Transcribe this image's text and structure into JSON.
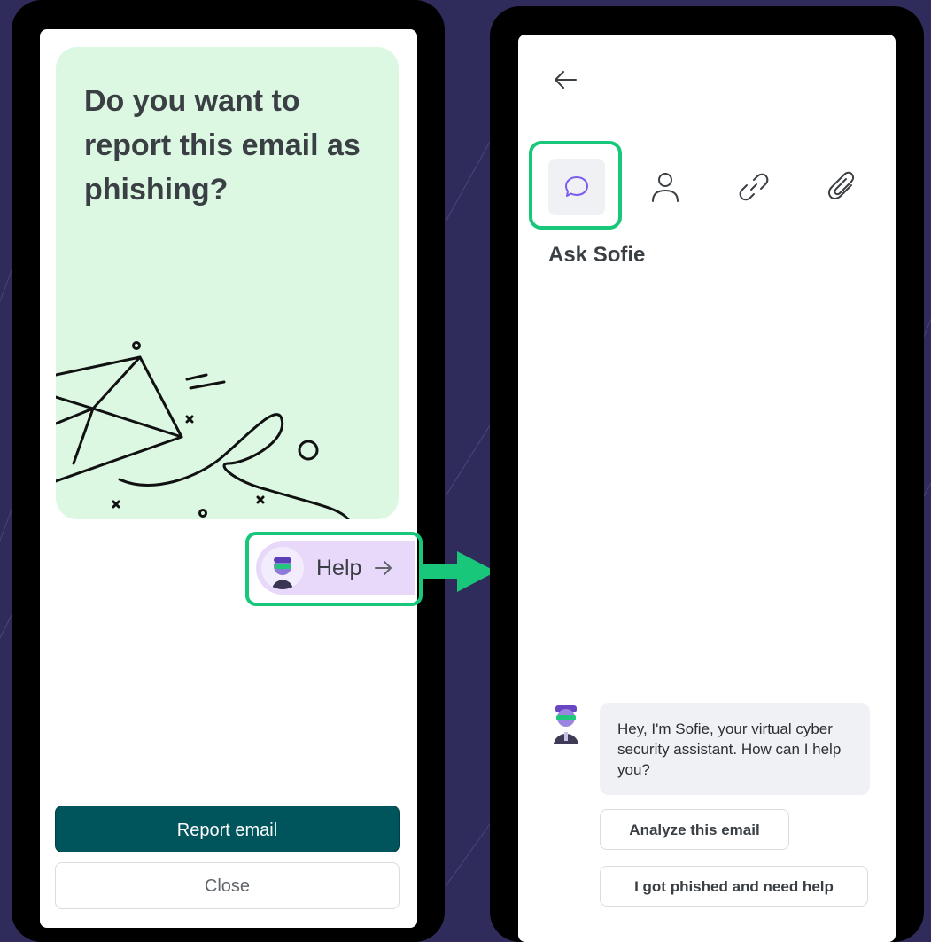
{
  "left_screen": {
    "question": "Do you want to report this email as phishing?",
    "help_label": "Help",
    "report_button": "Report email",
    "close_button": "Close"
  },
  "right_screen": {
    "tabs": [
      {
        "icon": "chat-bubble-icon",
        "selected": true
      },
      {
        "icon": "user-icon",
        "selected": false
      },
      {
        "icon": "link-icon",
        "selected": false
      },
      {
        "icon": "paperclip-icon",
        "selected": false
      }
    ],
    "panel_title": "Ask Sofie",
    "bot_message": "Hey, I'm Sofie, your virtual cyber security assistant. How can I help you?",
    "suggestions": [
      "Analyze this email",
      "I got phished and need help"
    ]
  },
  "colors": {
    "background": "#2f2c5c",
    "hero_green": "#dcf8e3",
    "primary_teal": "#00555c",
    "highlight_green": "#18c77a",
    "help_pill_purple": "#e8d9fb",
    "icon_purple": "#7b5cf0"
  }
}
